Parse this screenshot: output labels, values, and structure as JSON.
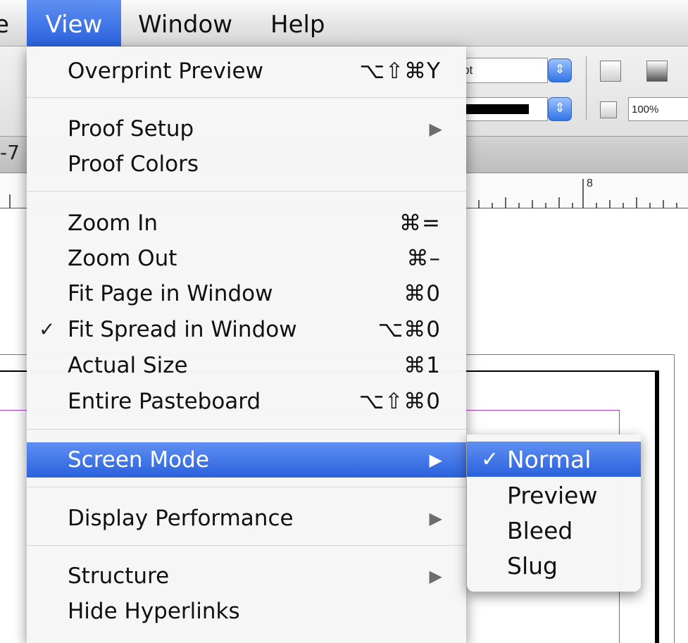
{
  "menubar": {
    "cut_item": "e",
    "items": [
      "View",
      "Window",
      "Help"
    ]
  },
  "toolbar": {
    "stroke_weight_unit": "pt",
    "opacity_value": "100%"
  },
  "document_tab": {
    "fragment": "-7"
  },
  "ruler": {
    "tick_label": "8"
  },
  "view_menu": {
    "items": [
      {
        "label": "Overprint Preview",
        "shortcut": "⌥⇧⌘Y"
      },
      {
        "label": "Proof Setup",
        "submenu_arrow": "▶"
      },
      {
        "label": "Proof Colors"
      },
      {
        "label": "Zoom In",
        "shortcut": "⌘="
      },
      {
        "label": "Zoom Out",
        "shortcut": "⌘–"
      },
      {
        "label": "Fit Page in Window",
        "shortcut": "⌘0"
      },
      {
        "label": "Fit Spread in Window",
        "shortcut": "⌥⌘0",
        "checked": true,
        "check_mark": "✓"
      },
      {
        "label": "Actual Size",
        "shortcut": "⌘1"
      },
      {
        "label": "Entire Pasteboard",
        "shortcut": "⌥⇧⌘0"
      },
      {
        "label": "Screen Mode",
        "submenu_arrow": "▶",
        "highlighted": true
      },
      {
        "label": "Display Performance",
        "submenu_arrow": "▶"
      },
      {
        "label": "Structure",
        "submenu_arrow": "▶"
      },
      {
        "label": "Hide Hyperlinks"
      }
    ]
  },
  "screen_mode_submenu": {
    "items": [
      {
        "label": "Normal",
        "checked": true,
        "check_mark": "✓",
        "highlighted": true
      },
      {
        "label": "Preview"
      },
      {
        "label": "Bleed"
      },
      {
        "label": "Slug"
      }
    ]
  },
  "colors": {
    "highlight": "#3a72e6",
    "menu_background": "#f6f6f6",
    "bleed_guide": "#e05050",
    "margin_guide": "#b23bd0"
  }
}
